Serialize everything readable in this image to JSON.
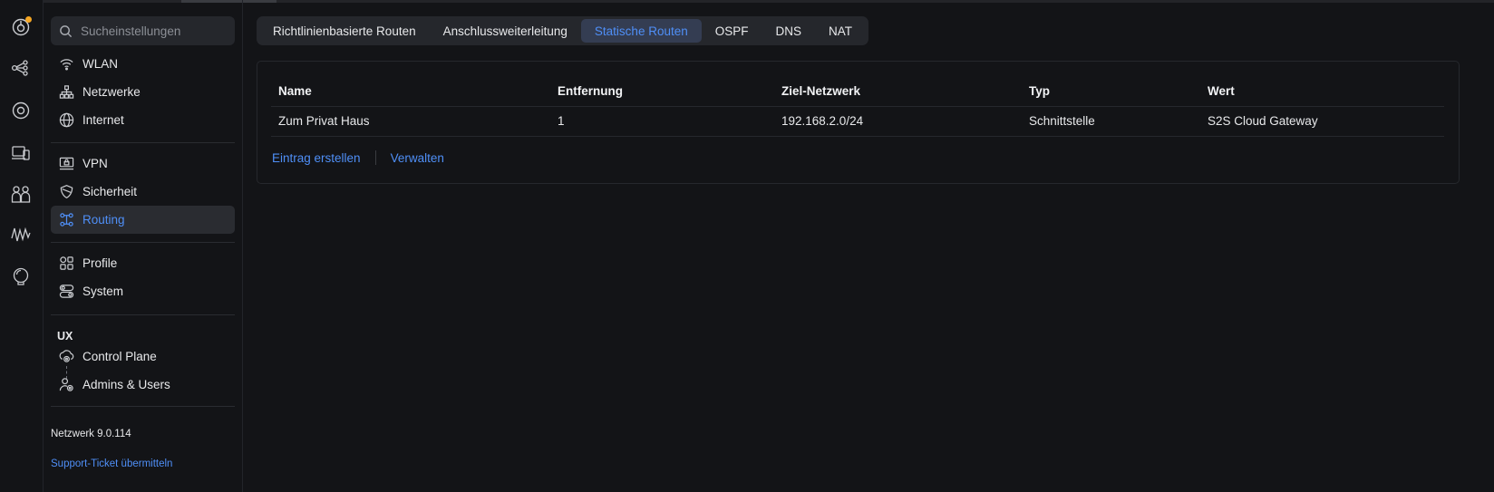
{
  "sidebar": {
    "search_placeholder": "Sucheinstellungen",
    "items": [
      {
        "label": "WLAN",
        "icon": "wifi-icon"
      },
      {
        "label": "Netzwerke",
        "icon": "network-tree-icon"
      },
      {
        "label": "Internet",
        "icon": "globe-icon"
      },
      {
        "label": "VPN",
        "icon": "vpn-icon"
      },
      {
        "label": "Sicherheit",
        "icon": "shield-icon"
      },
      {
        "label": "Routing",
        "icon": "routing-icon",
        "active": true
      },
      {
        "label": "Profile",
        "icon": "profile-grid-icon"
      },
      {
        "label": "System",
        "icon": "system-toggles-icon"
      }
    ],
    "ux_heading": "UX",
    "ux_items": [
      {
        "label": "Control Plane",
        "icon": "control-plane-icon"
      },
      {
        "label": "Admins & Users",
        "icon": "admins-users-icon"
      }
    ],
    "version": "Netzwerk 9.0.114",
    "support_link": "Support-Ticket übermitteln"
  },
  "tabs": [
    {
      "label": "Richtlinienbasierte Routen"
    },
    {
      "label": "Anschlussweiterleitung"
    },
    {
      "label": "Statische Routen",
      "active": true
    },
    {
      "label": "OSPF"
    },
    {
      "label": "DNS"
    },
    {
      "label": "NAT"
    }
  ],
  "table": {
    "columns": [
      "Name",
      "Entfernung",
      "Ziel-Netzwerk",
      "Typ",
      "Wert"
    ],
    "rows": [
      [
        "Zum Privat Haus",
        "1",
        "192.168.2.0/24",
        "Schnittstelle",
        "S2S Cloud Gateway"
      ]
    ]
  },
  "actions": {
    "create": "Eintrag erstellen",
    "manage": "Verwalten"
  },
  "colors": {
    "background": "#131417",
    "accent": "#4f8ff7",
    "notification": "#f5a623"
  }
}
